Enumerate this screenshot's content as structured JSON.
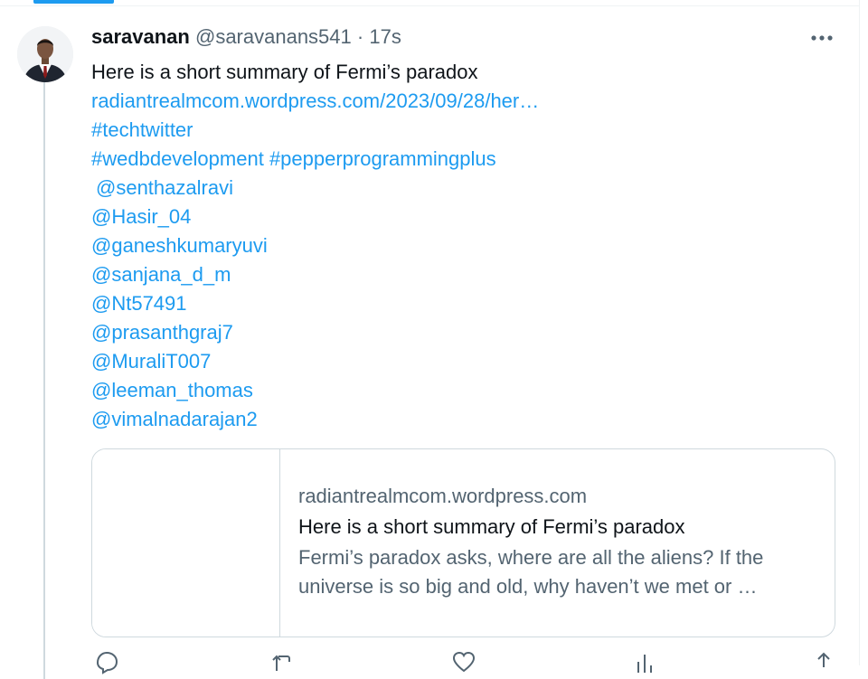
{
  "tweet": {
    "author_name": "saravanan",
    "author_handle": "@saravanans541",
    "separator": "·",
    "time": "17s",
    "text": "Here is a short summary of Fermi’s paradox",
    "url": "radiantrealmcom.wordpress.com/2023/09/28/her…",
    "hashtag_line_1": "#techtwitter",
    "hashtag_wedb": "#wedbdevelopment",
    "hashtag_pepper": "#pepperprogrammingplus",
    "mentions": [
      "@senthazalravi",
      "@Hasir_04",
      "@ganeshkumaryuvi",
      "@sanjana_d_m",
      "@Nt57491",
      "@prasanthgraj7",
      "@MuraliT007",
      "@leeman_thomas",
      "@vimalnadarajan2"
    ]
  },
  "card": {
    "domain": "radiantrealmcom.wordpress.com",
    "title": "Here is a short summary of Fermi’s paradox",
    "description_line_1": "Fermi’s paradox asks, where are all the aliens? If the",
    "description_line_2": "universe is so big and old, why haven’t we met or …"
  },
  "icons": {
    "more": "more-horizontal-icon",
    "reply": "reply-icon",
    "retweet": "retweet-icon",
    "like": "heart-icon",
    "views": "views-icon",
    "share": "share-icon"
  },
  "colors": {
    "accent": "#1d9bf0",
    "text_primary": "#0f1419",
    "text_secondary": "#536471",
    "border": "#cfd9de"
  }
}
